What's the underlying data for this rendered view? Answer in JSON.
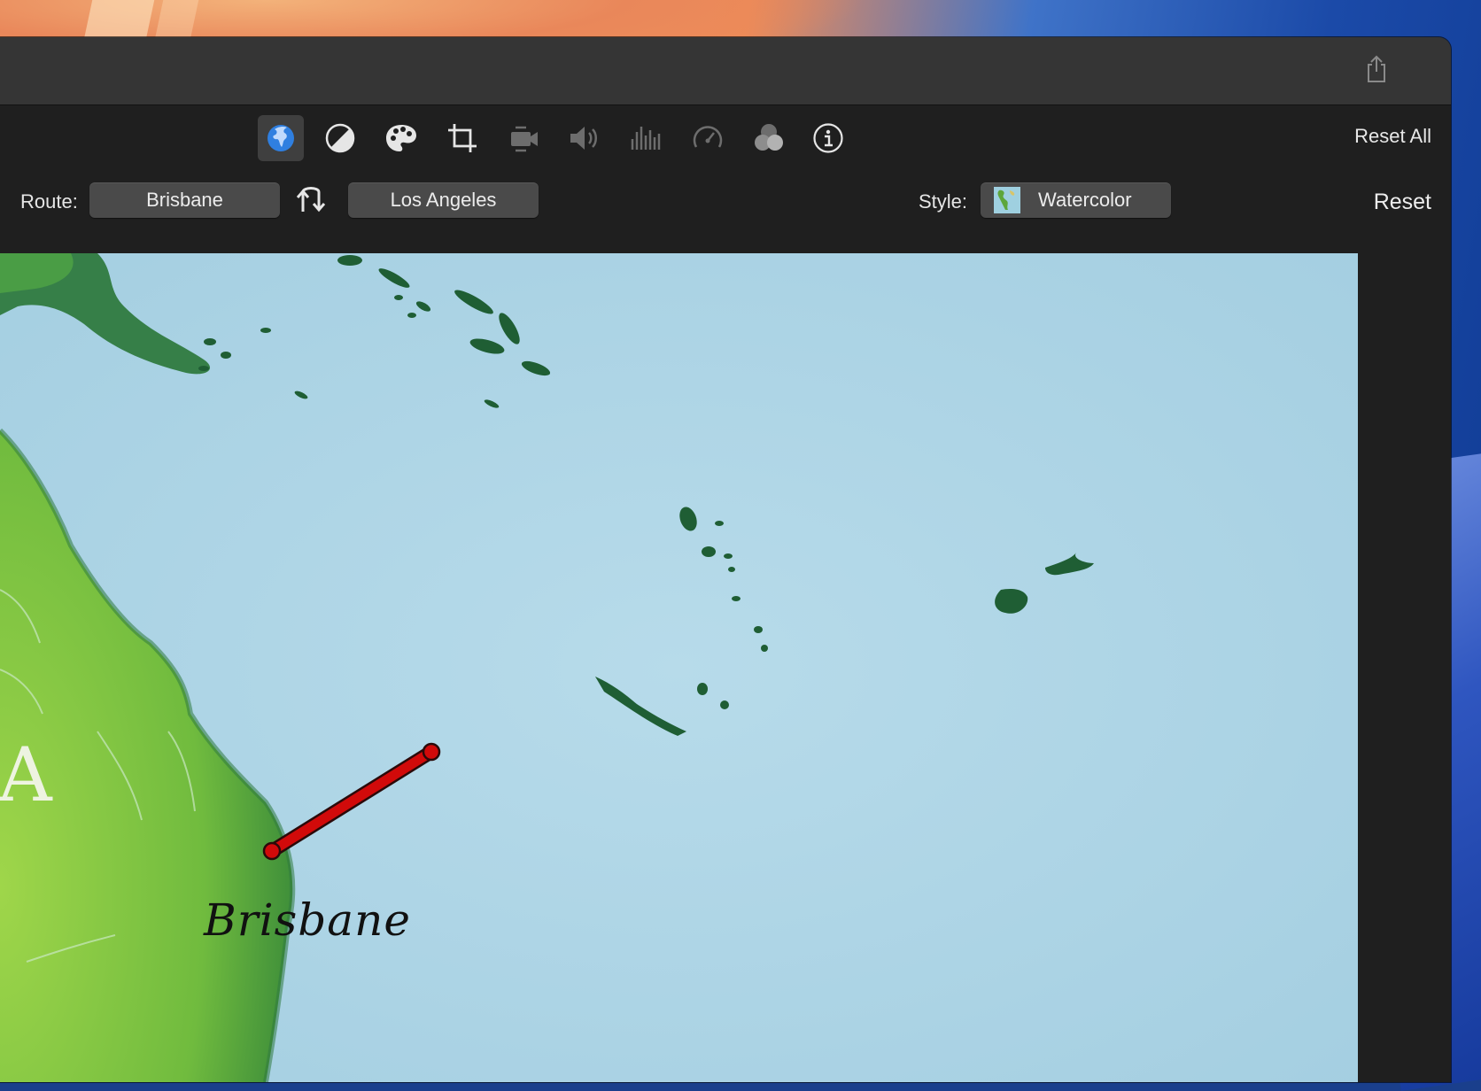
{
  "toolbar": {
    "tools": [
      {
        "name": "map-icon",
        "active": true
      },
      {
        "name": "color-balance-icon",
        "active": false
      },
      {
        "name": "color-correction-icon",
        "active": false
      },
      {
        "name": "crop-icon",
        "active": false
      },
      {
        "name": "stabilization-icon",
        "active": false
      },
      {
        "name": "volume-icon",
        "active": false
      },
      {
        "name": "noise-reduction-icon",
        "active": false
      },
      {
        "name": "speed-icon",
        "active": false
      },
      {
        "name": "clip-filter-icon",
        "active": false
      },
      {
        "name": "info-icon",
        "active": false
      }
    ],
    "reset_all_label": "Reset All"
  },
  "options": {
    "route_label": "Route:",
    "route_from": "Brisbane",
    "route_to": "Los Angeles",
    "style_label": "Style:",
    "style_value": "Watercolor",
    "reset_label": "Reset"
  },
  "map": {
    "city_label": "Brisbane",
    "region_letter": "A",
    "route_color": "#cc0000"
  },
  "colors": {
    "accent": "#3b82f6",
    "ocean": "#a9d3e4",
    "land": "#7cc24a",
    "island": "#1f5e34"
  }
}
